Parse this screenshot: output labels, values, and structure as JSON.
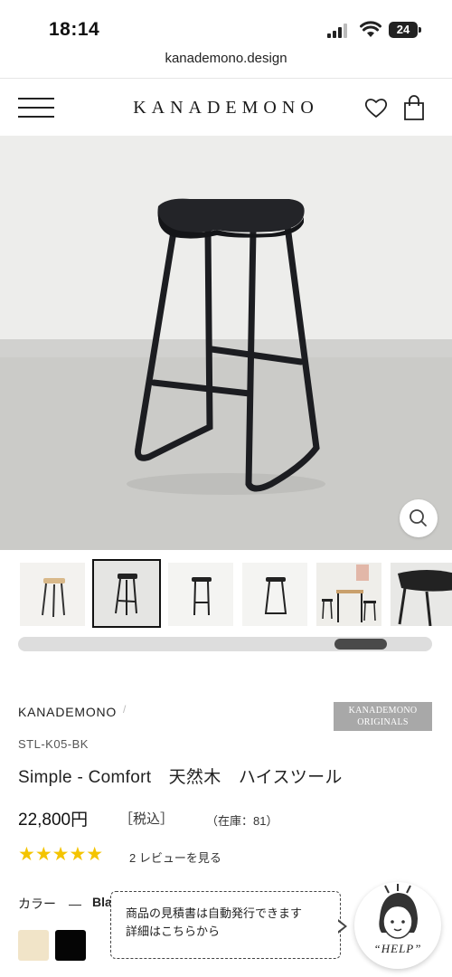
{
  "status_bar": {
    "time": "18:14",
    "battery": "24"
  },
  "browser": {
    "url": "kanademono.design"
  },
  "header": {
    "logo": "KANADEMONO"
  },
  "product": {
    "brand": "KANADEMONO",
    "brand_separator": "/",
    "originals_badge_line1": "KANADEMONO",
    "originals_badge_line2": "ORIGINALS",
    "sku": "STL-K05-BK",
    "title": "Simple - Comfort　天然木　ハイスツール",
    "price": "22,800円",
    "tax_label": "［税込］",
    "stock": "（在庫：81）",
    "rating": 5,
    "stars": "★★★★★",
    "reviews_link": "2 レビューを見る",
    "color_label": "カラー　—",
    "color_value": "Black",
    "swatches": [
      {
        "name": "natural",
        "color": "#f1e4c8"
      },
      {
        "name": "black",
        "color": "#050505"
      }
    ],
    "gallery_position": 0.88
  },
  "chat": {
    "line1": "商品の見積書は自動発行できます",
    "line2": "詳細はこちらから",
    "help_label": "“HELP”"
  },
  "colors": {
    "accent_star": "#f4c400",
    "badge_gray": "#a8a8a8"
  }
}
